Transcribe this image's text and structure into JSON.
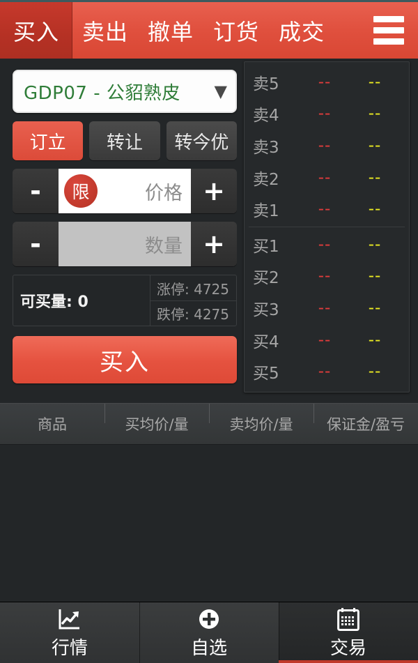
{
  "topnav": {
    "tabs": [
      {
        "label": "买入",
        "selected": true
      },
      {
        "label": "卖出",
        "selected": false
      },
      {
        "label": "撤单",
        "selected": false
      },
      {
        "label": "订货",
        "selected": false
      },
      {
        "label": "成交",
        "selected": false
      }
    ],
    "menu_icon": "hamburger-icon",
    "background_color": "#e0503e",
    "selected_color": "#b53124"
  },
  "order_pad": {
    "symbol": {
      "value": "GDP07  -  公貂熟皮",
      "chevron": "▼",
      "text_color": "#2f7d38"
    },
    "modes": [
      {
        "label": "订立",
        "active": true
      },
      {
        "label": "转让",
        "active": false
      },
      {
        "label": "转今优",
        "active": false
      }
    ],
    "price_row": {
      "minus": "-",
      "plus": "+",
      "badge": "限",
      "value": "",
      "placeholder": "价格"
    },
    "qty_row": {
      "minus": "-",
      "plus": "+",
      "value": "",
      "placeholder": "数量"
    },
    "info": {
      "available_label": "可买量: 0",
      "upper_limit": "涨停: 4725",
      "lower_limit": "跌停: 4275"
    },
    "submit_label": "买入",
    "submit_color": "#e5523f"
  },
  "order_book": {
    "price_color": "#e23c3c",
    "volume_color": "#ecec22",
    "sell_rows": [
      {
        "label": "卖5",
        "price": "--",
        "volume": "--"
      },
      {
        "label": "卖4",
        "price": "--",
        "volume": "--"
      },
      {
        "label": "卖3",
        "price": "--",
        "volume": "--"
      },
      {
        "label": "卖2",
        "price": "--",
        "volume": "--"
      },
      {
        "label": "卖1",
        "price": "--",
        "volume": "--"
      }
    ],
    "buy_rows": [
      {
        "label": "买1",
        "price": "--",
        "volume": "--"
      },
      {
        "label": "买2",
        "price": "--",
        "volume": "--"
      },
      {
        "label": "买3",
        "price": "--",
        "volume": "--"
      },
      {
        "label": "买4",
        "price": "--",
        "volume": "--"
      },
      {
        "label": "买5",
        "price": "--",
        "volume": "--"
      }
    ]
  },
  "positions": {
    "columns": [
      "商品",
      "买均价/量",
      "卖均价/量",
      "保证金/盈亏"
    ],
    "rows": []
  },
  "bottombar": {
    "tabs": [
      {
        "label": "行情",
        "icon": "chart-icon",
        "selected": false
      },
      {
        "label": "自选",
        "icon": "plus-circle-icon",
        "selected": false
      },
      {
        "label": "交易",
        "icon": "calendar-icon",
        "selected": true
      }
    ],
    "active_indicator_color": "#c0392b"
  }
}
